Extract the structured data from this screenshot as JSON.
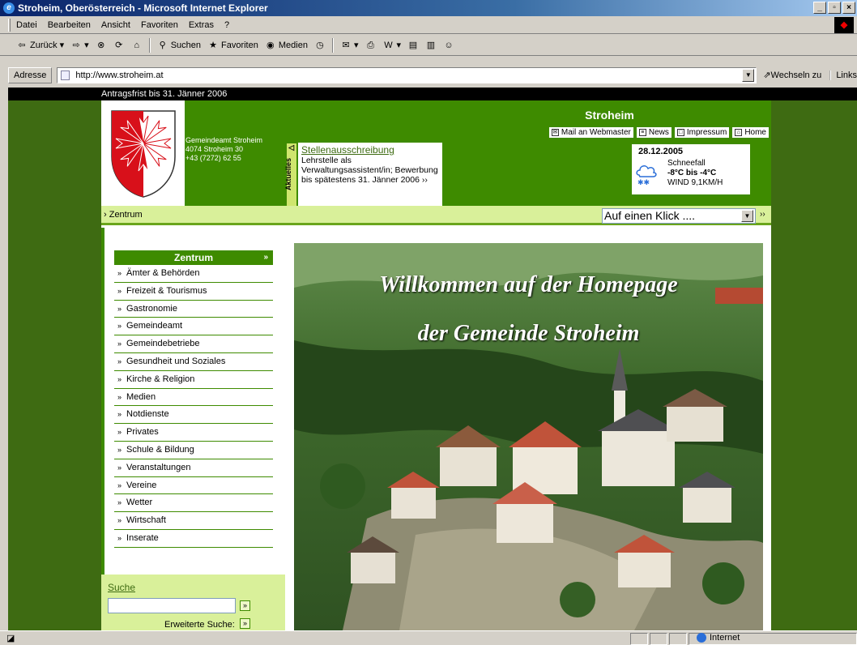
{
  "window": {
    "title": "Stroheim, Oberösterreich - Microsoft Internet Explorer"
  },
  "menubar": {
    "items": [
      "Datei",
      "Bearbeiten",
      "Ansicht",
      "Favoriten",
      "Extras",
      "?"
    ]
  },
  "toolbar": {
    "back": "Zurück",
    "search": "Suchen",
    "favorites": "Favoriten",
    "media": "Medien"
  },
  "address": {
    "label": "Adresse",
    "url": "http://www.stroheim.at",
    "go": "Wechseln zu",
    "links": "Links"
  },
  "page": {
    "top_strip": "Antragsfrist bis 31. Jänner 2006",
    "gemeindeamt": {
      "name": "Gemeindeamt Stroheim",
      "address": "4074 Stroheim 30",
      "phone": "+43 (7272) 62 55"
    },
    "site_name": "Stroheim",
    "top_links": [
      "Mail an Webmaster",
      "News",
      "Impressum",
      "Home"
    ],
    "aktuelles": {
      "tab": "Aktuelles",
      "headline": "Stellenausschreibung",
      "text": "Lehrstelle als Verwaltungsassistent/in; Bewerbung bis spätestens 31. Jänner 2006 ››"
    },
    "weather": {
      "date": "28.12.2005",
      "condition": "Schneefall",
      "temp": "-8°C bis -4°C",
      "wind": "WIND 9,1KM/H"
    },
    "breadcrumb": "› Zentrum",
    "quicklink": {
      "selected": "Auf einen Klick ....",
      "go": "››"
    },
    "menu": {
      "header": "Zentrum",
      "items": [
        "Ämter & Behörden",
        "Freizeit & Tourismus",
        "Gastronomie",
        "Gemeindeamt",
        "Gemeindebetriebe",
        "Gesundheit und Soziales",
        "Kirche & Religion",
        "Medien",
        "Notdienste",
        "Privates",
        "Schule & Bildung",
        "Veranstaltungen",
        "Vereine",
        "Wetter",
        "Wirtschaft",
        "Inserate"
      ]
    },
    "search": {
      "label": "Suche",
      "go": "»",
      "advanced": "Erweiterte Suche:"
    },
    "welcome": {
      "line1": "Willkommen auf der Homepage",
      "line2": "der Gemeinde Stroheim"
    }
  },
  "status": {
    "zone": "Internet"
  },
  "colors": {
    "site_green": "#3e8b00",
    "light_green": "#d9f09a",
    "link_green": "#3e6b12"
  }
}
